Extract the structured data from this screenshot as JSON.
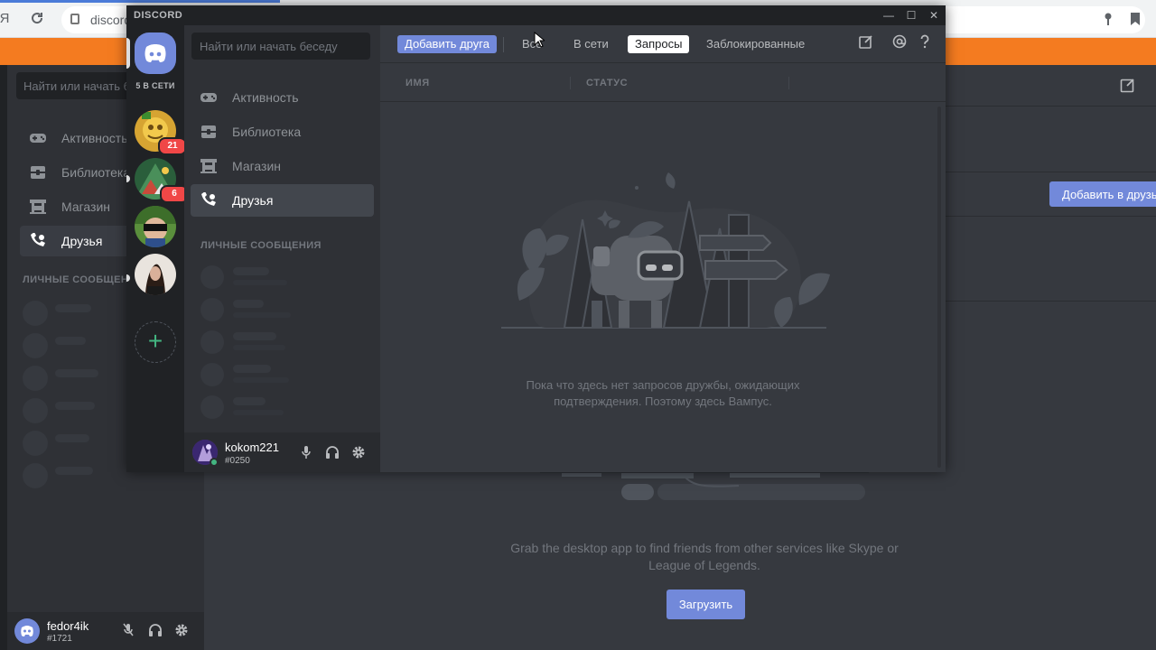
{
  "browser": {
    "tab_fragment": "Я",
    "url": "discord"
  },
  "bg_app": {
    "search_placeholder": "Найти или начать бес",
    "nav": [
      "Активность",
      "Библиотека",
      "Магазин",
      "Друзья"
    ],
    "dm_header": "ЛИЧНЫЕ СООБЩЕНИЯ",
    "user": {
      "name": "fedor4ik",
      "tag": "#1721"
    },
    "add_friend_label": "Добавить в друзья",
    "grab_text": "Grab the desktop app to find friends from other services like Skype or League of Legends.",
    "download_label": "Загрузить"
  },
  "window": {
    "title": "DISCORD",
    "controls": {
      "minimize": "—",
      "maximize": "☐",
      "close": "✕"
    }
  },
  "guilds": {
    "online_label": "5 В СЕТИ",
    "badges": [
      "21",
      "6"
    ],
    "add_server": "+"
  },
  "sidebar": {
    "search_placeholder": "Найти или начать беседу",
    "nav": [
      "Активность",
      "Библиотека",
      "Магазин",
      "Друзья"
    ],
    "active_index": 3,
    "dm_header": "ЛИЧНЫЕ СООБЩЕНИЯ",
    "user": {
      "name": "kokom221",
      "tag": "#0250"
    }
  },
  "friends": {
    "add_friend_label": "Добавить друга",
    "tabs": [
      "Все",
      "В сети",
      "Запросы",
      "Заблокированные"
    ],
    "active_tab": "Запросы",
    "columns": [
      "ИМЯ",
      "СТАТУС"
    ],
    "empty_text": "Пока что здесь нет запросов дружбы, ожидающих подтверждения. Поэтому здесь Вампус."
  },
  "colors": {
    "accent": "#7289da",
    "online": "#43b581",
    "badge": "#f04747",
    "browser_orange": "#f47b20"
  }
}
